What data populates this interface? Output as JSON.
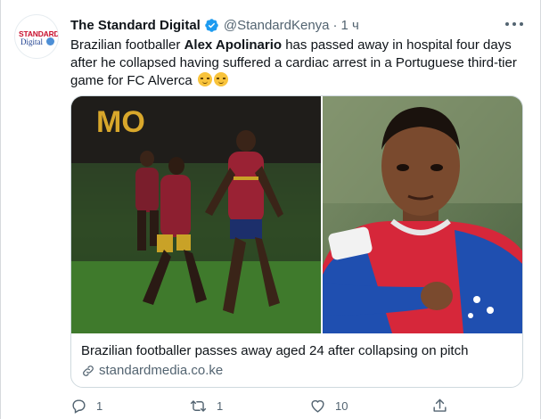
{
  "tweet": {
    "author": {
      "display_name": "The Standard Digital",
      "handle": "@StandardKenya",
      "separator": "·",
      "time": "1 ч",
      "avatar_line1": "STANDARD",
      "avatar_line2": "Digital"
    },
    "text": {
      "part1": "Brazilian footballer ",
      "bold": "Alex Apolinario",
      "part2": " has passed away in hospital four days after he collapsed having suffered a cardiac arrest in a Portuguese third-tier game for FC Alverca "
    },
    "emojis": [
      "pensive-face",
      "pensive-face"
    ],
    "card": {
      "title": "Brazilian footballer passes away aged 24 after collapsing on pitch",
      "domain": "standardmedia.co.ke",
      "image_text": "MO"
    },
    "actions": {
      "replies": "1",
      "retweets": "1",
      "likes": "10"
    }
  },
  "icons": {
    "verified": "verified-badge-icon",
    "more": "more-icon",
    "link": "link-icon",
    "reply": "reply-icon",
    "retweet": "retweet-icon",
    "like": "like-icon",
    "share": "share-icon"
  },
  "colors": {
    "verified_blue": "#1d9bf0",
    "text_primary": "#0f1419",
    "text_secondary": "#536471"
  }
}
